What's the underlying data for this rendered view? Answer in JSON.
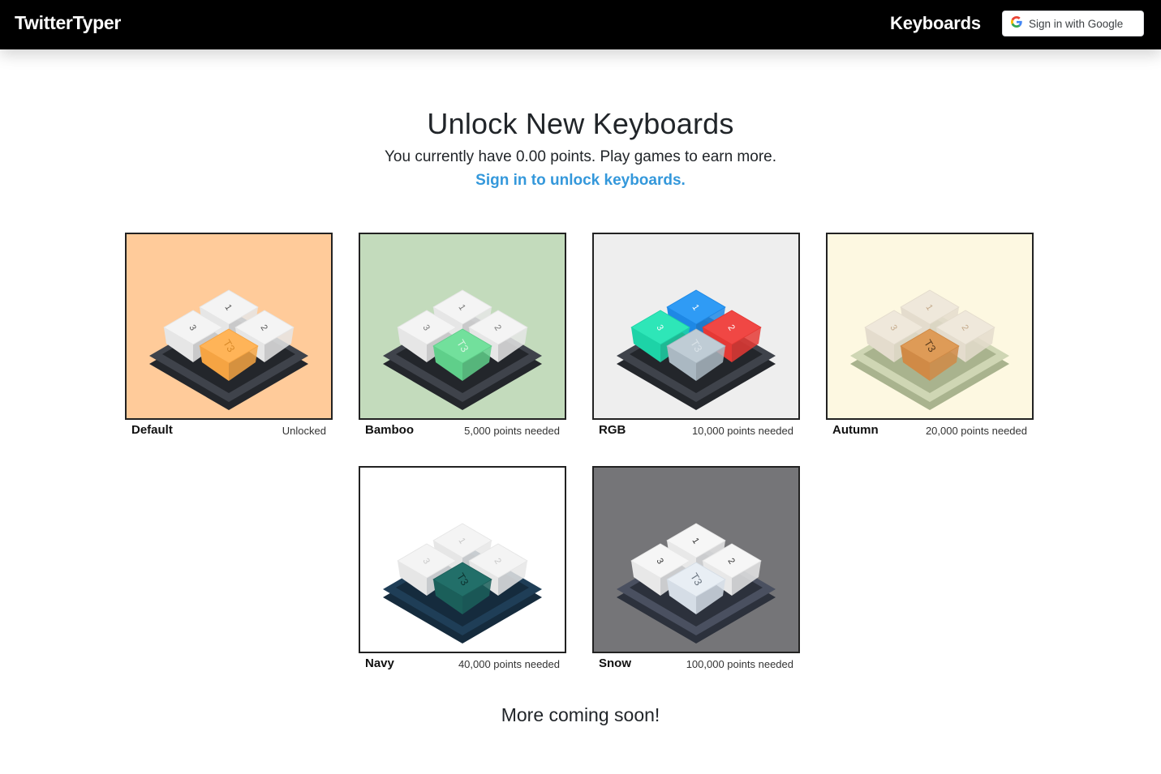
{
  "navbar": {
    "brand": "TwitterTyper",
    "link": "Keyboards",
    "google_button": "Sign in with Google"
  },
  "main": {
    "heading": "Unlock New Keyboards",
    "subheading": "You currently have 0.00 points. Play games to earn more.",
    "signin_link": "Sign in to unlock keyboards."
  },
  "keyboards": [
    {
      "name": "Default",
      "status": "Unlocked",
      "colors": {
        "bg": "#ffcb9a",
        "base": "#3f434b",
        "base_edge": "#23262b",
        "key": "#e6e6e6",
        "key_top": "#f4f4f4",
        "accent": "#f5a443",
        "accent_top": "#ffb458",
        "legend": "#555555",
        "accent_legend": "#d98a2a"
      }
    },
    {
      "name": "Bamboo",
      "status": "5,000 points needed",
      "colors": {
        "bg": "#c3dbbc",
        "base": "#3f434b",
        "base_edge": "#23262b",
        "key": "#e6e6e6",
        "key_top": "#f4f4f4",
        "accent": "#5fcf8a",
        "accent_top": "#72e09c",
        "legend": "#777777",
        "accent_legend": "#d6f5e1"
      }
    },
    {
      "name": "RGB",
      "status": "10,000 points needed",
      "colors": {
        "bg": "#eeeeee",
        "base": "#3f434b",
        "base_edge": "#23262b",
        "key_1": "#1e88e5",
        "key_1_top": "#2f9bf5",
        "key_2": "#e53935",
        "key_2_top": "#f04744",
        "key_3": "#1dd3a7",
        "key_3_top": "#2ee6b8",
        "accent": "#aab8c2",
        "accent_top": "#bfccd5",
        "legend": "#ffffff",
        "accent_legend": "#d9e2e8"
      }
    },
    {
      "name": "Autumn",
      "status": "20,000 points needed",
      "colors": {
        "bg": "#fdf8e1",
        "base": "#cfd6b4",
        "base_edge": "#a9b38e",
        "key": "#e4dccd",
        "key_top": "#efe8db",
        "accent": "#d08a46",
        "accent_top": "#de9b57",
        "legend": "#c4a98a",
        "accent_legend": "#5a3b1c"
      }
    },
    {
      "name": "Navy",
      "status": "40,000 points needed",
      "colors": {
        "bg": "#ffffff",
        "base": "#1f3e57",
        "base_edge": "#152b3d",
        "key": "#e6e6e6",
        "key_top": "#f4f4f4",
        "accent": "#1b5f5a",
        "accent_top": "#226f69",
        "legend": "#c8c8c8",
        "accent_legend": "#0d3431"
      }
    },
    {
      "name": "Snow",
      "status": "100,000 points needed",
      "colors": {
        "bg": "#757578",
        "base": "#4a5060",
        "base_edge": "#2c313c",
        "key": "#e8e8e8",
        "key_top": "#f6f6f6",
        "accent": "#d5dde6",
        "accent_top": "#e8eef4",
        "legend": "#333333",
        "accent_legend": "#6b7580"
      }
    }
  ],
  "key_legends": {
    "key_1": "1",
    "key_2": "2",
    "key_3": "3",
    "accent": "T3"
  },
  "footer": {
    "note": "More coming soon!"
  }
}
